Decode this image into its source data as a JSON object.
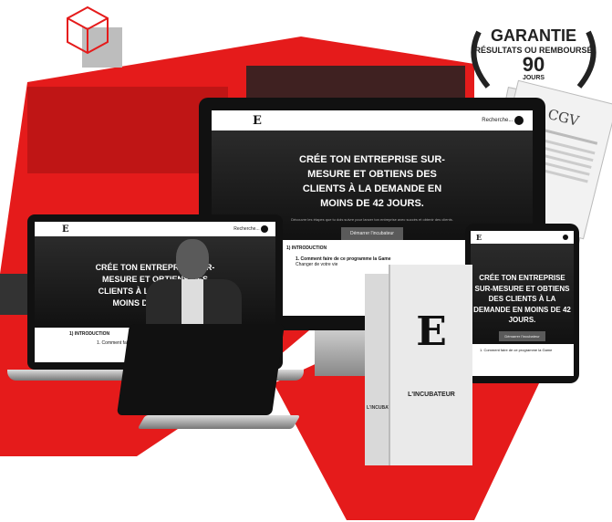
{
  "hero": {
    "title": "CRÉE TON ENTREPRISE SUR-MESURE ET OBTIENS DES CLIENTS À LA DEMANDE EN MOINS DE 42 JOURS.",
    "subtitle": "Découvre les étapes que tu dois suivre pour lancer ton entreprise avec succès et obtenir des clients.",
    "cta_label": "Démarrer l'incubateur"
  },
  "nav": {
    "logo": "E",
    "search_label": "Recherche..."
  },
  "content": {
    "section_label": "1) INTRODUCTION",
    "lesson_line_1": "1. Comment faire de ce programme la Game",
    "lesson_line_2": "Changer de votre vie"
  },
  "box": {
    "logo": "E",
    "name": "L'INCUBATEUR",
    "side_label": "L'INCUBATEUR"
  },
  "badge": {
    "line1": "GARANTIE",
    "line2": "RÉSULTATS OU REMBOURSÉ",
    "days": "90",
    "unit": "JOURS"
  },
  "document": {
    "title": "CGV"
  },
  "colors": {
    "accent": "#e51b1b",
    "dark": "#111111",
    "screen_bg": "#1e1e1e"
  }
}
